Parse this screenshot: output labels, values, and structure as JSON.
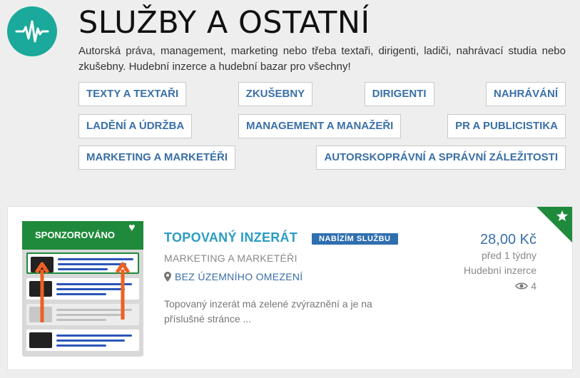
{
  "header": {
    "title": "SLUŽBY A OSTATNÍ",
    "description": "Autorská práva, management, marketing nebo třeba textaři, dirigenti, ladiči, nahrávací studia nebo zkušebny. Hudební inzerce a hudební bazar pro všechny!",
    "logo_icon": "pulse-icon",
    "logo_color": "#1aa99b"
  },
  "categories": [
    [
      "TEXTY A TEXTAŘI",
      "ZKUŠEBNY",
      "DIRIGENTI",
      "NAHRÁVÁNÍ"
    ],
    [
      "LADĚNÍ A ÚDRŽBA",
      "MANAGEMENT A MANAŽEŘI",
      "PR A PUBLICISTIKA"
    ],
    [
      "MARKETING A MARKETÉŘI",
      "AUTORSKOPRÁVNÍ A SPRÁVNÍ ZÁLEŽITOSTI"
    ]
  ],
  "listing": {
    "sponsored_label": "SPONZOROVÁNO",
    "title": "TOPOVANÝ INZERÁT",
    "badge": "NABÍZÍM SLUŽBU",
    "category": "MARKETING A MARKETÉŘI",
    "location": "BEZ ÚZEMNÍHO OMEZENÍ",
    "text": "Topovaný inzerát má zelené zvýraznění a je na příslušné stránce ...",
    "price": "28,00 Kč",
    "posted": "před 1 týdny",
    "section": "Hudební inzerce",
    "views": "4",
    "accent_color": "#1f8a3b",
    "arrow_color": "#f06022"
  }
}
